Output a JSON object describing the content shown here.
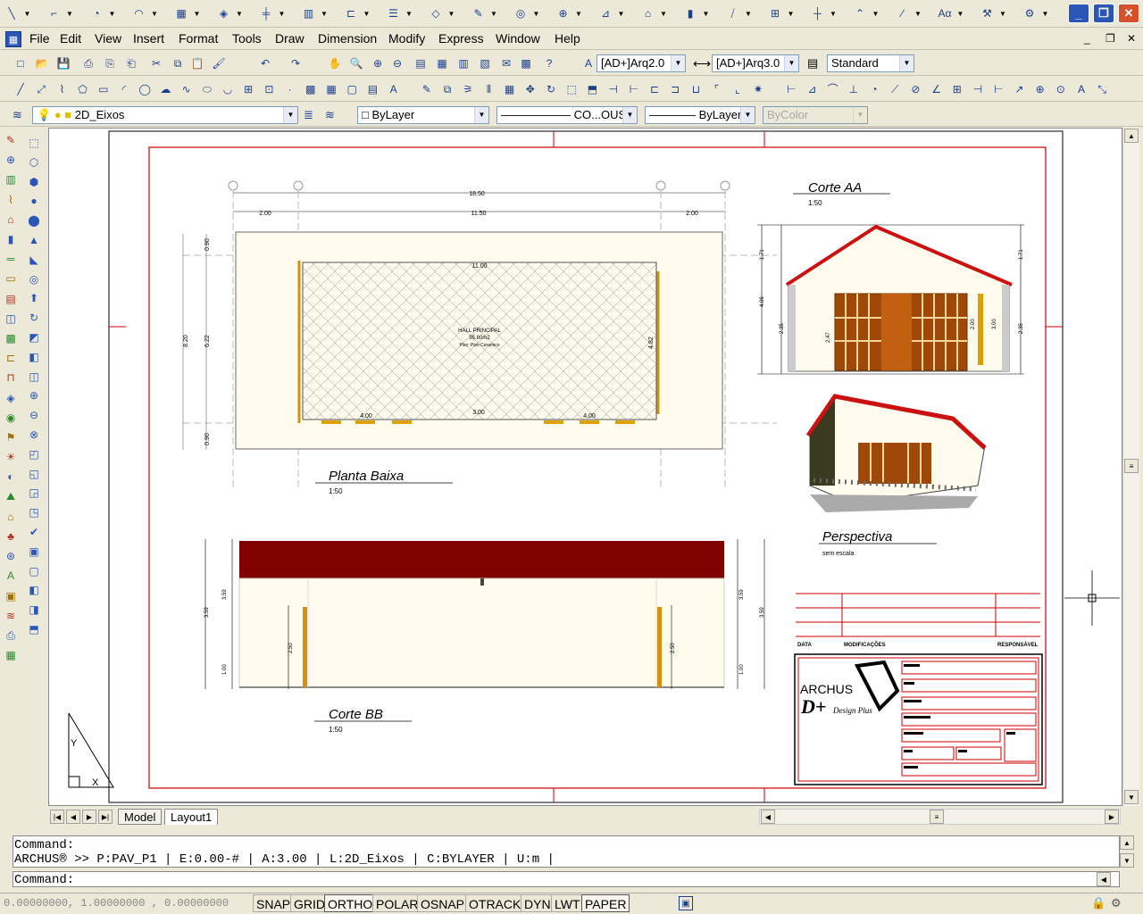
{
  "title_bar": {
    "icons": [
      "line-icon",
      "polyline-icon",
      "circle-icon",
      "arc-icon",
      "layer-icon",
      "cube-icon",
      "grid-icon",
      "block-icon",
      "door-icon",
      "list-icon",
      "hatch-icon",
      "pencil-icon",
      "target-icon",
      "zoom-icon",
      "dimension-icon",
      "wall-icon",
      "column-icon",
      "stair-icon",
      "window-icon",
      "ruler-icon",
      "roof-icon",
      "slash-icon",
      "attribute-icon",
      "tools-icon",
      "settings-icon"
    ],
    "controls": [
      "_",
      "❐",
      "✕"
    ]
  },
  "menu": [
    "File",
    "Edit",
    "View",
    "Insert",
    "Format",
    "Tools",
    "Draw",
    "Dimension",
    "Modify",
    "Express",
    "Window",
    "Help"
  ],
  "mdi_controls": [
    "_",
    "❐",
    "✕"
  ],
  "style_toolbar": {
    "text_style": "[AD+]Arq2.0",
    "dim_style": "[AD+]Arq3.0",
    "table_style": "Standard"
  },
  "layer_toolbar": {
    "layer": "2D_Eixos",
    "color": "ByLayer",
    "linetype": "CO...OUS",
    "lineweight": "ByLayer",
    "plotstyle": "ByColor"
  },
  "drawing": {
    "plan_title": "Planta Baixa",
    "plan_scale": "1:50",
    "room_name": "HALL PRINCIPAL",
    "room_area": "95.80m2",
    "room_floor": "Piso: Piso Ceramico",
    "dim_total": "18.50",
    "dim_inner": "11.50",
    "dim_left": "2.00",
    "dim_right": "2.00",
    "dim_door_left": "4.00",
    "dim_door_mid": "3.00",
    "dim_door_right": "4.00",
    "dim_vert_total": "8.20",
    "dim_vert_inner": "6.22",
    "dim_vert_top": "0.90",
    "dim_vert_bottom": "0.90",
    "dim_room_w": "11.00",
    "dim_room_h": "4.82",
    "section_aa_title": "Corte AA",
    "section_aa_scale": "1:50",
    "section_aa_dims": [
      "1.71",
      "4.06",
      "2.35",
      "2.47",
      "2.00",
      "3.00",
      "1.71",
      "2.35"
    ],
    "persp_title": "Perspectiva",
    "persp_scale": "sem escala",
    "section_bb_title": "Corte BB",
    "section_bb_scale": "1:50",
    "section_bb_dims": [
      "3.59",
      "3.59",
      "1.00",
      "2.50",
      "2.50",
      "3.59",
      "3.59",
      "1.00"
    ],
    "revision_headers": [
      "DATA",
      "MODIFICAÇÕES",
      "RESPONSÁVEL"
    ],
    "logo_text": "ARCHUS",
    "logo_sub": "D+",
    "logo_design": "Design Plus"
  },
  "tabs": [
    "Model",
    "Layout1"
  ],
  "command": {
    "line1": "Command:",
    "line2": "ARCHUS® >> P:PAV_P1 | E:0.00-# | A:3.00 | L:2D_Eixos | C:BYLAYER | U:m |",
    "prompt": "Command:"
  },
  "status": {
    "coords": "0.00000000, 1.00000000 , 0.00000000",
    "toggles": [
      "SNAP",
      "GRID",
      "ORTHO",
      "POLAR",
      "OSNAP",
      "OTRACK",
      "DYN",
      "LWT",
      "PAPER"
    ],
    "on": [
      "ORTHO",
      "PAPER"
    ]
  },
  "colors": {
    "frame": "#cc0000",
    "roof": "#800000",
    "wood": "#b05a10",
    "wall": "#fffcee",
    "accent": "#2a56b8"
  }
}
